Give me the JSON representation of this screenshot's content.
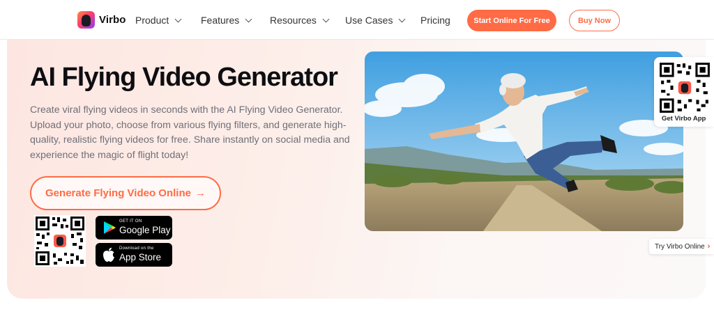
{
  "header": {
    "brand": "Virbo",
    "menu": [
      {
        "label": "Product",
        "has_dropdown": true
      },
      {
        "label": "Features",
        "has_dropdown": true
      },
      {
        "label": "Resources",
        "has_dropdown": true
      },
      {
        "label": "Use Cases",
        "has_dropdown": true
      },
      {
        "label": "Pricing",
        "has_dropdown": false
      }
    ],
    "start_button": "Start Online For Free",
    "buy_button": "Buy Now"
  },
  "hero": {
    "title": "AI Flying Video Generator",
    "description": "Create viral flying videos in seconds with the AI Flying Video Generator. Upload your photo, choose from various flying filters, and generate high-quality, realistic flying videos for free. Share instantly on social media and experience the magic of flight today!",
    "cta": "Generate Flying Video Online",
    "cta_arrow": "→",
    "google_play": {
      "small": "GET IT ON",
      "big": "Google Play"
    },
    "app_store": {
      "small": "Download on the",
      "big": "App Store"
    }
  },
  "side": {
    "qr_caption": "Get Virbo App",
    "try_online": "Try Virbo Online",
    "try_arrow": "›"
  },
  "colors": {
    "accent": "#ff6b45",
    "hero_bg": "#fde6e1",
    "text_muted": "#6f6f78"
  },
  "icons": {
    "logo": "virbo-logo-icon",
    "chevron": "chevron-down-icon",
    "play": "google-play-icon",
    "apple": "apple-icon",
    "qr": "qr-code-icon"
  }
}
